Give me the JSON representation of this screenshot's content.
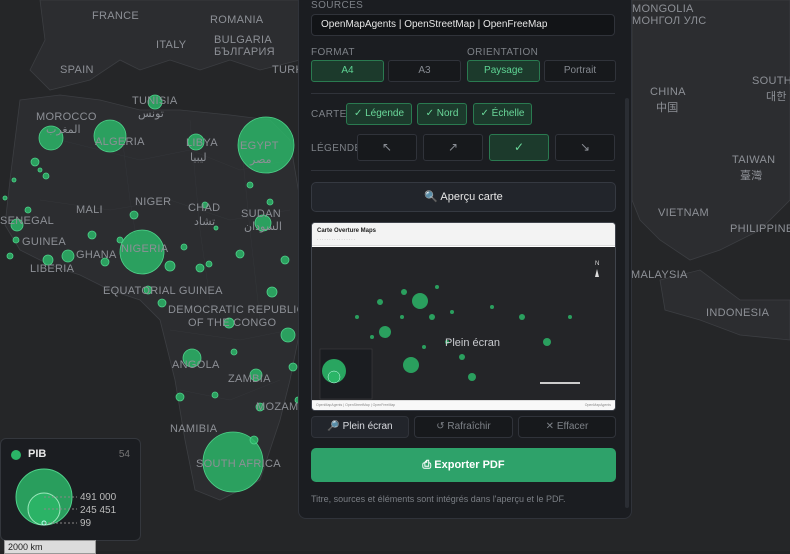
{
  "map": {
    "countries": [
      {
        "id": "france",
        "label": "FRANCE"
      },
      {
        "id": "romania",
        "label": "ROMANIA"
      },
      {
        "id": "italy",
        "label": "ITALY"
      },
      {
        "id": "bulgaria",
        "label": "BULGARIA"
      },
      {
        "id": "bulgaria-cyr",
        "label": "БЪЛГАРИЯ"
      },
      {
        "id": "spain",
        "label": "SPAIN"
      },
      {
        "id": "turkey",
        "label": "TURK"
      },
      {
        "id": "tunisia",
        "label": "TUNISIA"
      },
      {
        "id": "tunisia-ar",
        "label": "تونس"
      },
      {
        "id": "morocco",
        "label": "MOROCCO"
      },
      {
        "id": "morocco-ar",
        "label": "المغرب"
      },
      {
        "id": "algeria",
        "label": "ALGERIA"
      },
      {
        "id": "libya",
        "label": "LIBYA"
      },
      {
        "id": "libya-ar",
        "label": "ليبيا"
      },
      {
        "id": "egypt",
        "label": "EGYPT"
      },
      {
        "id": "egypt-ar",
        "label": "مصر"
      },
      {
        "id": "niger",
        "label": "NIGER"
      },
      {
        "id": "mali",
        "label": "MALI"
      },
      {
        "id": "chad",
        "label": "CHAD"
      },
      {
        "id": "chad-ar",
        "label": "تشاد"
      },
      {
        "id": "sudan",
        "label": "SUDAN"
      },
      {
        "id": "sudan-ar",
        "label": "السودان"
      },
      {
        "id": "senegal",
        "label": "SENEGAL"
      },
      {
        "id": "guinea",
        "label": "GUINEA"
      },
      {
        "id": "liberia",
        "label": "LIBERIA"
      },
      {
        "id": "ghana",
        "label": "GHANA"
      },
      {
        "id": "nigeria",
        "label": "NIGERIA"
      },
      {
        "id": "eq-guinea",
        "label": "EQUATORIAL GUINEA"
      },
      {
        "id": "drc1",
        "label": "DEMOCRATIC REPUBLIC"
      },
      {
        "id": "drc2",
        "label": "OF THE CONGO"
      },
      {
        "id": "angola",
        "label": "ANGOLA"
      },
      {
        "id": "zambia",
        "label": "ZAMBIA"
      },
      {
        "id": "mozambique",
        "label": "MOZAMB"
      },
      {
        "id": "namibia",
        "label": "NAMIBIA"
      },
      {
        "id": "south-africa",
        "label": "SOUTH AFRICA"
      },
      {
        "id": "mongolia",
        "label": "MONGOLIA"
      },
      {
        "id": "mongolia-cyr",
        "label": "МОНГОЛ УЛС"
      },
      {
        "id": "china",
        "label": "CHINA"
      },
      {
        "id": "china-zh",
        "label": "中国"
      },
      {
        "id": "south-korea",
        "label": "SOUTH"
      },
      {
        "id": "south-korea-ko",
        "label": "대한"
      },
      {
        "id": "taiwan",
        "label": "TAIWAN"
      },
      {
        "id": "taiwan-zh",
        "label": "臺灣"
      },
      {
        "id": "vietnam",
        "label": "VIETNAM"
      },
      {
        "id": "philippines",
        "label": "PHILIPPINES"
      },
      {
        "id": "malaysia",
        "label": "MALAYSIA"
      },
      {
        "id": "indonesia",
        "label": "INDONESIA"
      }
    ],
    "bubble_color": "#2bb567"
  },
  "legend": {
    "title": "PIB",
    "count": "54",
    "values": [
      "491 000",
      "245 451",
      "99"
    ]
  },
  "scale": "2000 km",
  "panel": {
    "sources_label": "SOURCES",
    "sources_value": "OpenMapAgents | OpenStreetMap | OpenFreeMap",
    "format_label": "FORMAT",
    "format_options": [
      "A4",
      "A3"
    ],
    "format_selected": "A4",
    "orientation_label": "ORIENTATION",
    "orientation_options": [
      "Paysage",
      "Portrait"
    ],
    "orientation_selected": "Paysage",
    "carte_label": "CARTE",
    "carte_options": [
      "✓ Légende",
      "✓ Nord",
      "✓ Échelle"
    ],
    "legende_label": "LÉGENDE",
    "legend_positions": [
      "↖",
      "↗",
      "✓",
      "↘"
    ],
    "apercu_label": "🔍 Aperçu carte",
    "preview": {
      "title": "Carte Overture Maps",
      "overlay": "Plein écran",
      "footer_left": "OpenMapAgents | OpenStreetMap | OpenFreeMap",
      "footer_right": "OpenMapAgents"
    },
    "actions": [
      "🔎 Plein écran",
      "↺ Rafraîchir",
      "✕ Effacer"
    ],
    "export_label": "⎙ Exporter PDF",
    "footnote": "Titre, sources et éléments sont intégrés dans l'aperçu et le PDF."
  },
  "colors": {
    "accent": "#2ea26a",
    "selected_bg": "#1c3a2c",
    "selected_text": "#5ed494"
  }
}
